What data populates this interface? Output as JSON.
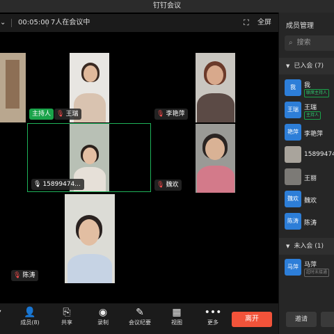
{
  "window": {
    "title": "钉钉会议"
  },
  "topbar": {
    "timer": "00:05:00",
    "participant_count": "7人在会议中",
    "fullscreen_label": "全屏"
  },
  "stage": {
    "host_badge": "主持人",
    "tiles": {
      "wangrui": "王瑞",
      "liyanping": "李艳萍",
      "phone": "15899474...",
      "weihuan": "魏欢",
      "chentao": "陈涛"
    }
  },
  "toolbar": {
    "members": "成员(8)",
    "share": "共享",
    "record": "录制",
    "minutes": "会议纪要",
    "view": "视图",
    "more": "更多",
    "leave": "离开"
  },
  "sidebar": {
    "title": "成员管理",
    "search_placeholder": "搜索",
    "joined_header": "已入会 (7)",
    "joined": [
      {
        "avatar": "我",
        "name": "我",
        "tag": "联席主持人"
      },
      {
        "avatar": "王瑞",
        "name": "王瑞",
        "tag": "主持人"
      },
      {
        "avatar": "艳萍",
        "name": "李艳萍"
      },
      {
        "avatar": "",
        "name": "15899474"
      },
      {
        "avatar": "",
        "name": "王丽"
      },
      {
        "avatar": "魏欢",
        "name": "魏欢"
      },
      {
        "avatar": "陈涛",
        "name": "陈涛"
      }
    ],
    "notjoined_header": "未入会 (1)",
    "notjoined": [
      {
        "avatar": "马萍",
        "name": "马萍",
        "tag": "超时未接通"
      }
    ],
    "invite": "邀请"
  },
  "colors": {
    "accent_green": "#1aa34a",
    "leave_red": "#f2533a",
    "avatar_blue": "#2d7ed8"
  }
}
